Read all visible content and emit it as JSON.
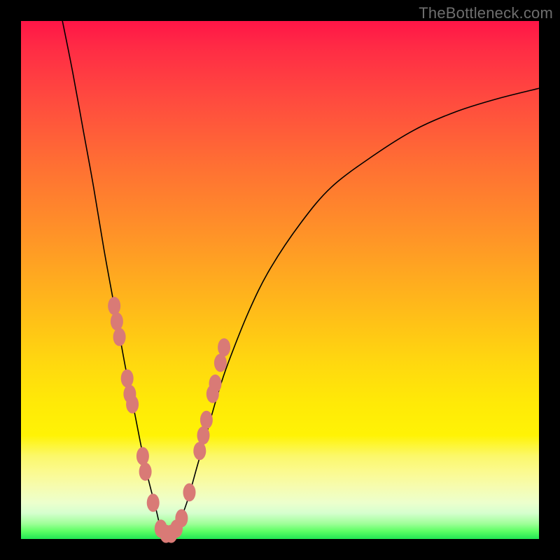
{
  "watermark": "TheBottleneck.com",
  "colors": {
    "frame_background": "#000000",
    "curve_stroke": "#000000",
    "blob_fill": "#d97a76",
    "gradient_stops": [
      {
        "pct": 0,
        "hex": "#ff1547"
      },
      {
        "pct": 15,
        "hex": "#ff4a3f"
      },
      {
        "pct": 42,
        "hex": "#ff9527"
      },
      {
        "pct": 66,
        "hex": "#ffd80f"
      },
      {
        "pct": 84,
        "hex": "#fbf86b"
      },
      {
        "pct": 95,
        "hex": "#d6ffce"
      },
      {
        "pct": 100,
        "hex": "#22e653"
      }
    ]
  },
  "chart_data": {
    "type": "line",
    "title": "",
    "xlabel": "",
    "ylabel": "",
    "xlim": [
      0,
      100
    ],
    "ylim": [
      0,
      100
    ],
    "note": "V-shaped bottleneck curve; minimum (optimal match) around x≈28. x/y are ratios in percent of the plot area; y=0 is bottom (green/optimal), y=100 is top (red/severe bottleneck).",
    "series": [
      {
        "name": "bottleneck-curve",
        "x": [
          8,
          10,
          12,
          14,
          16,
          18,
          20,
          22,
          24,
          26,
          27,
          28,
          29,
          30,
          32,
          34,
          36,
          38,
          40,
          44,
          48,
          54,
          60,
          68,
          76,
          84,
          92,
          100
        ],
        "y": [
          100,
          90,
          79,
          68,
          56,
          45,
          34,
          24,
          14,
          6,
          2,
          0.5,
          0.5,
          2,
          7,
          14,
          21,
          28,
          34,
          44,
          52,
          61,
          68,
          74,
          79,
          82.5,
          85,
          87
        ]
      }
    ],
    "highlight_clusters": {
      "description": "Salmon-colored blobs overlaid on the curve near its lower segment; approximate centers in same percent coordinates.",
      "points": [
        {
          "x": 18.0,
          "y": 45
        },
        {
          "x": 18.5,
          "y": 42
        },
        {
          "x": 19.0,
          "y": 39
        },
        {
          "x": 20.5,
          "y": 31
        },
        {
          "x": 21.0,
          "y": 28
        },
        {
          "x": 21.5,
          "y": 26
        },
        {
          "x": 23.5,
          "y": 16
        },
        {
          "x": 24.0,
          "y": 13
        },
        {
          "x": 25.5,
          "y": 7
        },
        {
          "x": 27.0,
          "y": 2
        },
        {
          "x": 28.0,
          "y": 1
        },
        {
          "x": 29.0,
          "y": 1
        },
        {
          "x": 30.0,
          "y": 2
        },
        {
          "x": 31.0,
          "y": 4
        },
        {
          "x": 32.5,
          "y": 9
        },
        {
          "x": 34.5,
          "y": 17
        },
        {
          "x": 35.2,
          "y": 20
        },
        {
          "x": 35.8,
          "y": 23
        },
        {
          "x": 37.0,
          "y": 28
        },
        {
          "x": 37.5,
          "y": 30
        },
        {
          "x": 38.5,
          "y": 34
        },
        {
          "x": 39.2,
          "y": 37
        }
      ]
    }
  }
}
